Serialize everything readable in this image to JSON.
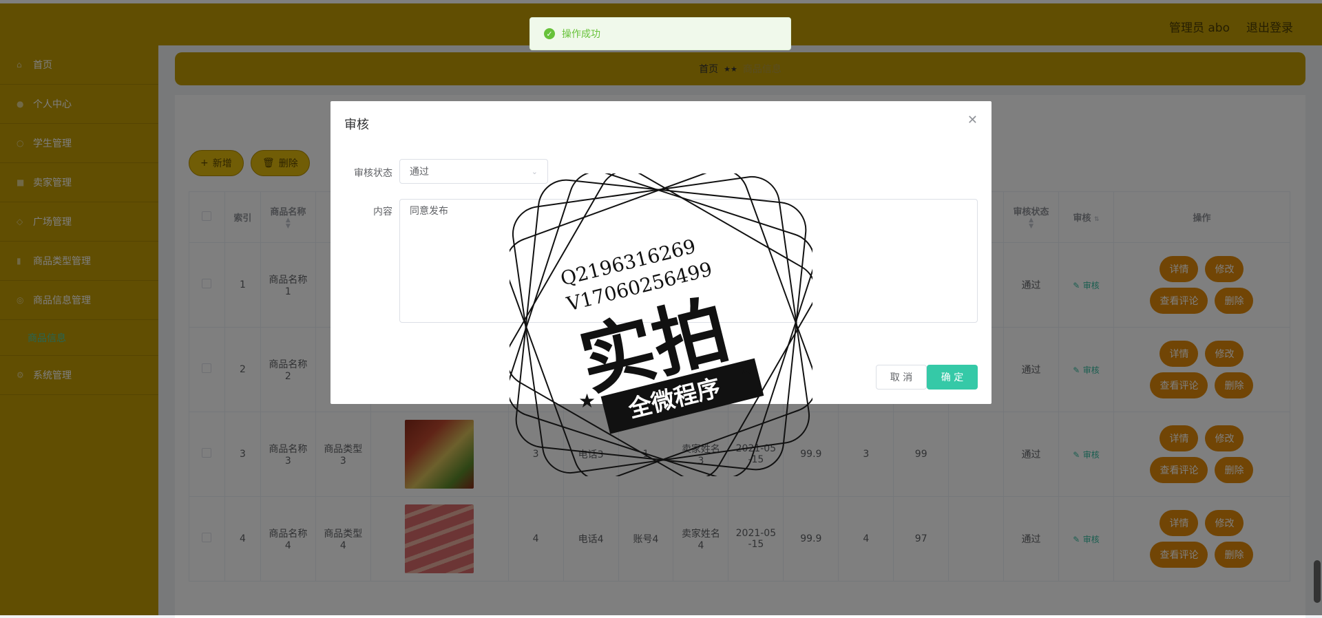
{
  "header": {
    "admin_label": "管理员 abo",
    "logout": "退出登录"
  },
  "sidebar": {
    "items": [
      {
        "label": "首页",
        "icon": "home-icon"
      },
      {
        "label": "个人中心",
        "icon": "user-icon"
      },
      {
        "label": "学生管理",
        "icon": "student-icon"
      },
      {
        "label": "卖家管理",
        "icon": "seller-icon"
      },
      {
        "label": "广场管理",
        "icon": "square-icon"
      },
      {
        "label": "商品类型管理",
        "icon": "category-icon"
      },
      {
        "label": "商品信息管理",
        "icon": "goods-icon"
      }
    ],
    "sub_item": "商品信息",
    "last_item": "系统管理"
  },
  "breadcrumb": {
    "home": "首页",
    "separator": "★★",
    "current": "商品信息"
  },
  "toolbar": {
    "add": "新增",
    "delete": "删除"
  },
  "table": {
    "headers": {
      "index": "索引",
      "name": "商品名称",
      "name2": "商",
      "audit_status": "审核状态",
      "audit": "审核",
      "ops": "操作"
    },
    "rows": [
      {
        "index": "1",
        "name": "商品名称\n1",
        "type": "商",
        "status": "通过",
        "audit": "审核"
      },
      {
        "index": "2",
        "name": "商品名称\n2",
        "type": "商",
        "status": "通过",
        "audit": "审核"
      },
      {
        "index": "3",
        "name": "商品名称\n3",
        "type": "商品类型\n3",
        "stock": "3",
        "phone": "电话3",
        "account": "1",
        "seller": "卖家姓名\n3",
        "date": "2021-05\n-15",
        "price": "99.9",
        "c1": "3",
        "c2": "99",
        "status": "通过",
        "audit": "审核"
      },
      {
        "index": "4",
        "name": "商品名称\n4",
        "type": "商品类型\n4",
        "stock": "4",
        "phone": "电话4",
        "account": "账号4",
        "seller": "卖家姓名\n4",
        "date": "2021-05\n-15",
        "price": "99.9",
        "c1": "4",
        "c2": "97",
        "status": "通过",
        "audit": "审核"
      }
    ],
    "op_labels": {
      "detail": "详情",
      "edit": "修改",
      "comments": "查看评论",
      "remove": "删除"
    }
  },
  "dialog": {
    "title": "审核",
    "status_label": "审核状态",
    "status_value": "通过",
    "content_label": "内容",
    "content_value": "同意发布",
    "cancel": "取 消",
    "confirm": "确 定"
  },
  "toast": {
    "message": "操作成功"
  },
  "watermark": {
    "line1": "Q2196316269",
    "line2": "V17060256499",
    "big": "实拍",
    "banner": "全微程序"
  },
  "colors": {
    "primary": "#c29c05",
    "accent": "#35c9a7",
    "op": "#e28a0b",
    "success": "#67c23a"
  }
}
